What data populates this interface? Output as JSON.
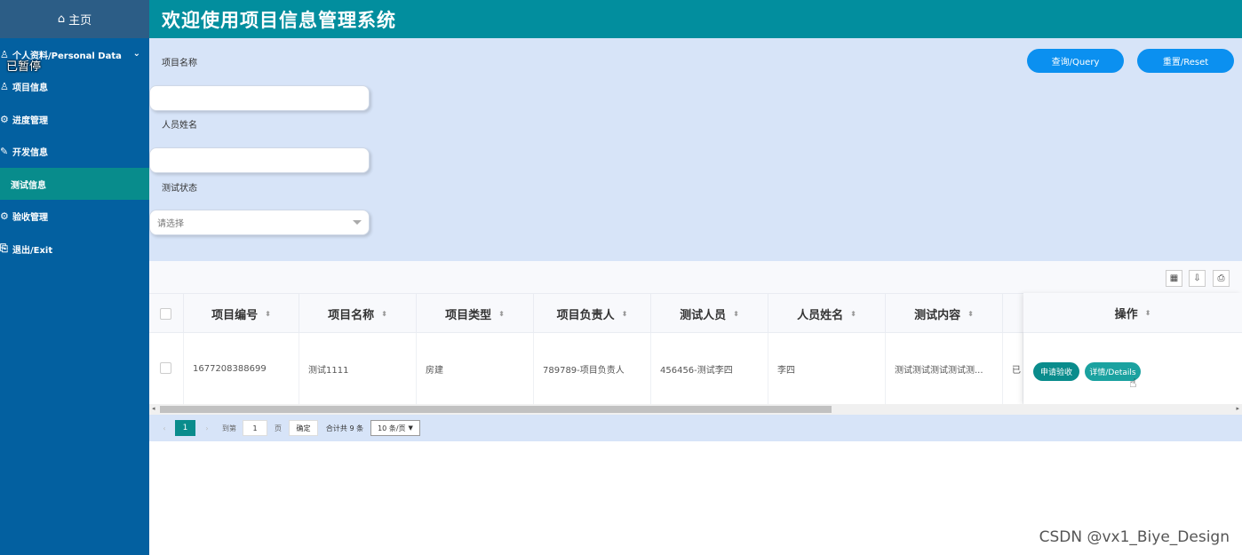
{
  "sidebar": {
    "home_label": "主页",
    "paused_label": "已暂停",
    "items": [
      {
        "label": "个人资料/Personal Data",
        "icon": "user-icon"
      },
      {
        "label": "项目信息",
        "icon": "user-icon"
      },
      {
        "label": "进度管理",
        "icon": "gear-icon"
      },
      {
        "label": "开发信息",
        "icon": "tools-icon"
      },
      {
        "label": "测试信息",
        "icon": ""
      },
      {
        "label": "验收管理",
        "icon": "settings-icon"
      },
      {
        "label": "退出/Exit",
        "icon": "exit-icon"
      }
    ]
  },
  "header": {
    "title": "欢迎使用项目信息管理系统"
  },
  "search": {
    "project_name_label": "项目名称",
    "project_name_value": "",
    "person_name_label": "人员姓名",
    "person_name_value": "",
    "status_label": "测试状态",
    "status_placeholder": "请选择",
    "query_button": "查询/Query",
    "reset_button": "重置/Reset"
  },
  "table": {
    "columns": [
      "项目编号",
      "项目名称",
      "项目类型",
      "项目负责人",
      "测试人员",
      "人员姓名",
      "测试内容",
      "操作"
    ],
    "rows": [
      {
        "id": "1677208388699",
        "name": "测试1111",
        "type": "房建",
        "manager": "789789-项目负责人",
        "tester": "456456-测试李四",
        "person": "李四",
        "content": "测试测试测试测试测...",
        "partial": "已",
        "actions": [
          "申请验收",
          "详情/Details"
        ]
      }
    ]
  },
  "pager": {
    "current_page": "1",
    "goto_prefix": "到第",
    "goto_value": "1",
    "goto_suffix": "页",
    "confirm": "确定",
    "total": "合计共 9 条",
    "page_size": "10 条/页"
  },
  "watermark": "CSDN @vx1_Biye_Design",
  "colors": {
    "sidebar": "#0360a0",
    "header": "#028e9e",
    "panel": "#d7e4f8",
    "primary_button": "#0b90f0",
    "teal": "#0a8c8c"
  }
}
